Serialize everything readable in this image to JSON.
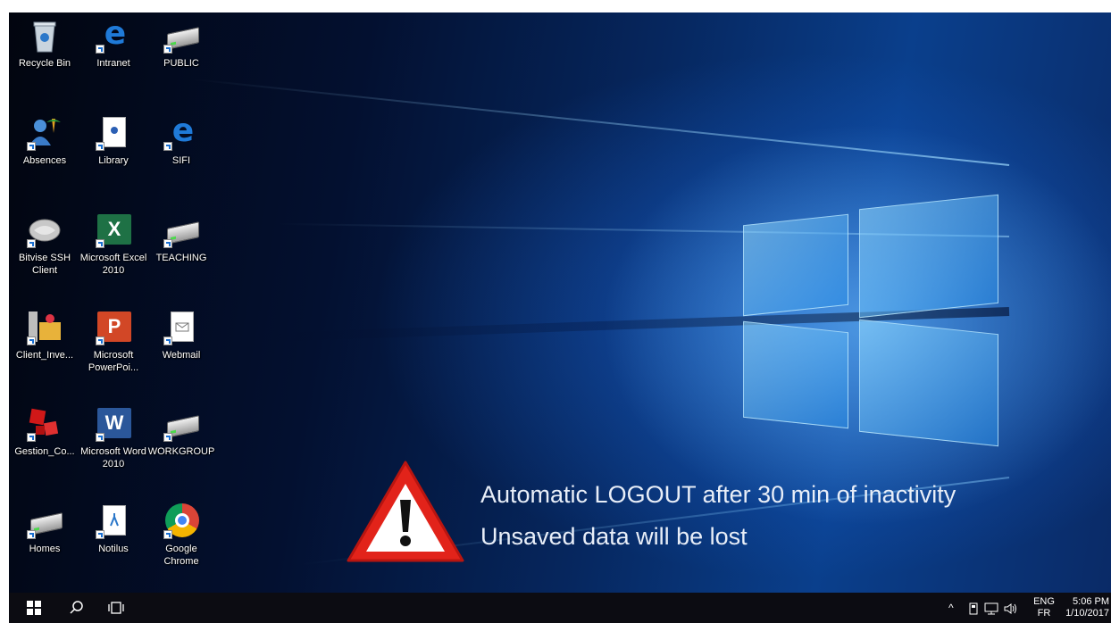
{
  "desktop": {
    "icons": [
      {
        "label": "Recycle Bin",
        "icon": "recycle-bin-icon"
      },
      {
        "label": "Intranet",
        "icon": "internet-explorer-icon"
      },
      {
        "label": "PUBLIC",
        "icon": "network-drive-icon"
      },
      {
        "label": "Absences",
        "icon": "absences-app-icon"
      },
      {
        "label": "Library",
        "icon": "library-doc-icon"
      },
      {
        "label": "SIFI",
        "icon": "internet-explorer-icon"
      },
      {
        "label": "Bitvise SSH Client",
        "icon": "bitvise-ssh-icon"
      },
      {
        "label": "Microsoft Excel 2010",
        "icon": "excel-icon"
      },
      {
        "label": "TEACHING",
        "icon": "network-drive-icon"
      },
      {
        "label": "Client_Inve...",
        "icon": "client-inventory-icon"
      },
      {
        "label": "Microsoft PowerPoi...",
        "icon": "powerpoint-icon"
      },
      {
        "label": "Webmail",
        "icon": "webmail-icon"
      },
      {
        "label": "Gestion_Co...",
        "icon": "gestion-icon"
      },
      {
        "label": "Microsoft Word 2010",
        "icon": "word-icon"
      },
      {
        "label": "WORKGROUP",
        "icon": "network-drive-icon"
      },
      {
        "label": "Homes",
        "icon": "network-drive-icon"
      },
      {
        "label": "Notilus",
        "icon": "notilus-icon"
      },
      {
        "label": "Google Chrome",
        "icon": "chrome-icon"
      }
    ]
  },
  "warning": {
    "line1": "Automatic LOGOUT after 30 min of inactivity",
    "line2": "Unsaved data will be lost",
    "icon": "warning-triangle-icon",
    "color": "#e2231a"
  },
  "taskbar": {
    "start_icon": "windows-start-icon",
    "search_icon": "search-icon",
    "task_view_icon": "task-view-icon",
    "tray": {
      "lang_top": "ENG",
      "lang_bottom": "FR",
      "time": "5:06 PM",
      "date": "1/10/2017"
    }
  },
  "colors": {
    "taskbar_bg": "#0c0c12",
    "wallpaper_glow": "#2f8ef0"
  }
}
